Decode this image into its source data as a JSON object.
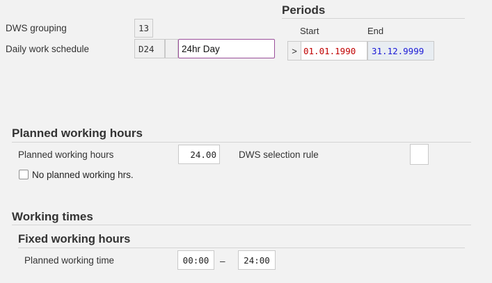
{
  "periods": {
    "title": "Periods",
    "start_label": "Start",
    "end_label": "End",
    "nav_button": ">",
    "start_value": "01.01.1990",
    "end_value": "31.12.9999"
  },
  "header": {
    "dws_grouping_label": "DWS grouping",
    "dws_grouping_value": "13",
    "daily_work_schedule_label": "Daily work schedule",
    "daily_work_schedule_value": "D24",
    "description_value": "24hr Day"
  },
  "planned": {
    "section_title": "Planned working hours",
    "hours_label": "Planned working hours",
    "hours_value": "24.00",
    "selection_rule_label": "DWS selection rule",
    "selection_rule_value": "",
    "no_planned_label": "No planned working hrs."
  },
  "working_times": {
    "section_title": "Working times",
    "fixed_title": "Fixed working hours",
    "planned_time_label": "Planned working time",
    "from_value": "00:00",
    "separator": "–",
    "to_value": "24:00"
  },
  "colors": {
    "start_date": "#c00000",
    "end_date": "#1a1ad6",
    "focus_border": "#9b4f9b"
  }
}
